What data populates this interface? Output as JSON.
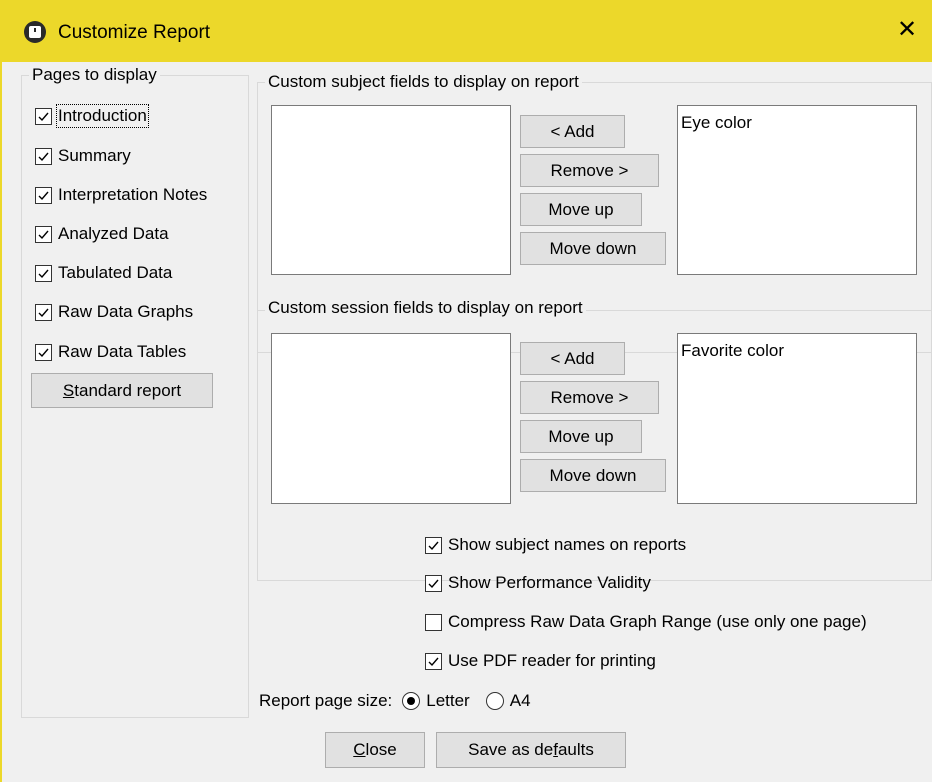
{
  "window": {
    "title": "Customize Report",
    "app_icon": "app-icon",
    "close_icon": "close-icon",
    "close_glyph": "✕"
  },
  "pages": {
    "legend": "Pages to display",
    "items": [
      {
        "label": "Introduction",
        "checked": true
      },
      {
        "label": "Summary",
        "checked": true
      },
      {
        "label": "Interpretation Notes",
        "checked": true
      },
      {
        "label": "Analyzed Data",
        "checked": true
      },
      {
        "label": "Tabulated Data",
        "checked": true
      },
      {
        "label": "Raw Data Graphs",
        "checked": true
      },
      {
        "label": "Raw Data Tables",
        "checked": true
      }
    ],
    "standard_report_prefix": "S",
    "standard_report_rest": "tandard report"
  },
  "subject_fields": {
    "legend": "Custom subject fields to display on report",
    "available": [],
    "selected": [
      "Eye color"
    ],
    "add_label": "< Add",
    "remove_label": "Remove >",
    "move_up_label": "Move up",
    "move_down_label": "Move down"
  },
  "session_fields": {
    "legend": "Custom session fields to display on report",
    "available": [],
    "selected": [
      "Favorite color"
    ],
    "add_label": "< Add",
    "remove_label": "Remove >",
    "move_up_label": "Move up",
    "move_down_label": "Move down"
  },
  "options": [
    {
      "label": "Show subject names on reports",
      "checked": true
    },
    {
      "label": "Show Performance Validity",
      "checked": true
    },
    {
      "label": "Compress Raw Data Graph Range (use only one page)",
      "checked": false
    },
    {
      "label": "Use PDF reader for printing",
      "checked": true
    }
  ],
  "page_size": {
    "label": "Report page size:",
    "options": [
      {
        "label": "Letter",
        "selected": true
      },
      {
        "label": "A4",
        "selected": false
      }
    ]
  },
  "footer": {
    "close_prefix": "C",
    "close_rest": "lose",
    "save_prefix": "Save as de",
    "save_accel": "f",
    "save_rest": "aults"
  }
}
